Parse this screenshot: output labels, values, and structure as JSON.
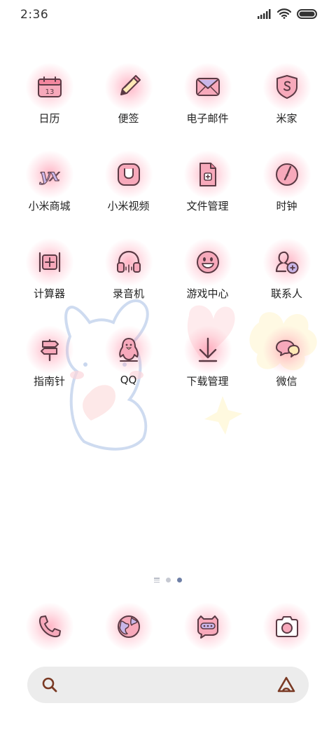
{
  "status_bar": {
    "time": "2:36",
    "icons": [
      "cellular-signal-icon",
      "wifi-icon",
      "battery-icon"
    ]
  },
  "apps": [
    {
      "label": "日历",
      "icon": "calendar-icon",
      "icon_text": "13"
    },
    {
      "label": "便签",
      "icon": "notes-pencil-icon"
    },
    {
      "label": "电子邮件",
      "icon": "email-icon"
    },
    {
      "label": "米家",
      "icon": "mijia-shield-icon"
    },
    {
      "label": "小米商城",
      "icon": "mi-store-icon",
      "icon_text": "yx"
    },
    {
      "label": "小米视频",
      "icon": "video-icon"
    },
    {
      "label": "文件管理",
      "icon": "file-manager-icon"
    },
    {
      "label": "时钟",
      "icon": "clock-icon"
    },
    {
      "label": "计算器",
      "icon": "calculator-icon"
    },
    {
      "label": "录音机",
      "icon": "headphones-icon"
    },
    {
      "label": "游戏中心",
      "icon": "smiley-icon"
    },
    {
      "label": "联系人",
      "icon": "add-contact-icon"
    },
    {
      "label": "指南针",
      "icon": "signpost-icon"
    },
    {
      "label": "QQ",
      "icon": "penguin-icon"
    },
    {
      "label": "下载管理",
      "icon": "download-arrow-icon"
    },
    {
      "label": "微信",
      "icon": "chat-bubbles-icon"
    }
  ],
  "page_indicator": {
    "pages": 3,
    "active_page": 3
  },
  "dock": [
    {
      "icon": "phone-icon"
    },
    {
      "icon": "browser-globe-icon"
    },
    {
      "icon": "messages-cat-icon"
    },
    {
      "icon": "camera-icon"
    }
  ],
  "search_bar": {
    "placeholder": "",
    "icons": [
      "search-icon",
      "assistant-icon"
    ]
  },
  "colors": {
    "icon_fill": "#f5a3b6",
    "icon_stroke": "#5a3a44",
    "glow": "#ff7896",
    "accent_lavender": "#c9b6e8",
    "active_dot": "#6e7fa6",
    "search_bg": "#ececec",
    "search_icon": "#7a3a24"
  }
}
